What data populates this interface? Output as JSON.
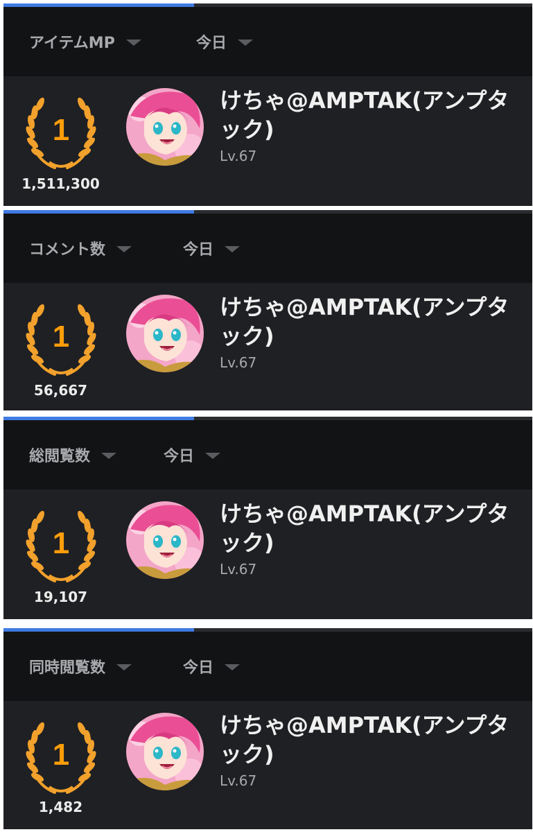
{
  "panels": [
    {
      "progress": 0.36,
      "metric_label": "アイテムMP",
      "period_label": "今日",
      "rank": "1",
      "score": "1,511,300",
      "username": "けちゃ@AMPTAK(アンプタック)",
      "level": "Lv.67"
    },
    {
      "progress": 0.36,
      "metric_label": "コメント数",
      "period_label": "今日",
      "rank": "1",
      "score": "56,667",
      "username": "けちゃ@AMPTAK(アンプタック)",
      "level": "Lv.67"
    },
    {
      "progress": 0.36,
      "metric_label": "総閲覧数",
      "period_label": "今日",
      "rank": "1",
      "score": "19,107",
      "username": "けちゃ@AMPTAK(アンプタック)",
      "level": "Lv.67"
    },
    {
      "progress": 0.36,
      "metric_label": "同時閲覧数",
      "period_label": "今日",
      "rank": "1",
      "score": "1,482",
      "username": "けちゃ@AMPTAK(アンプタック)",
      "level": "Lv.67"
    }
  ],
  "icons": {
    "dropdown": "caret-down-icon",
    "rank": "laurel-wreath-icon",
    "avatar": "user-avatar"
  },
  "colors": {
    "accent": "#3f7be3",
    "laurel": "#f2a12c",
    "rank_number": "#ff9d0a",
    "header_bg": "#121315",
    "row_bg": "#1f2023"
  }
}
